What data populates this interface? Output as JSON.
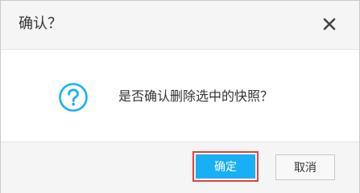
{
  "dialog": {
    "title": "确认？",
    "close_icon": "close-icon",
    "message": "是否确认删除选中的快照？",
    "message_icon": "question-circle-icon",
    "confirm_label": "确定",
    "cancel_label": "取消"
  },
  "colors": {
    "accent": "#18aff5",
    "highlight_border": "#e0423b",
    "header_bg": "#f5f5f5",
    "text": "#333333"
  }
}
